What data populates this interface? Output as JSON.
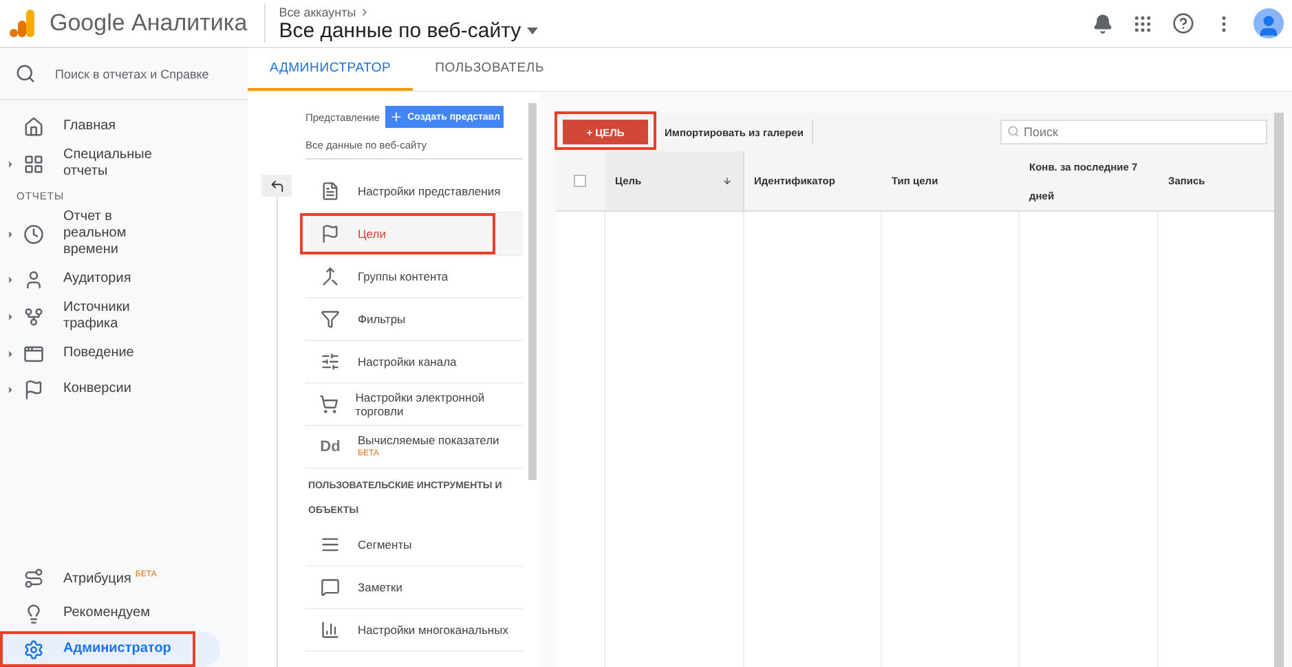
{
  "header": {
    "product": "Google Аналитика",
    "breadcrumb": "Все аккаунты",
    "view_title": "Все данные по веб-сайту"
  },
  "sidebar": {
    "search_placeholder": "Поиск в отчетах и Справке",
    "top_items": [
      {
        "label": "Главная",
        "expandable": false
      },
      {
        "label": "Специальные отчеты",
        "expandable": true
      }
    ],
    "section": "ОТЧЕТЫ",
    "report_items": [
      {
        "label": "Отчет в реальном времени",
        "expandable": true
      },
      {
        "label": "Аудитория",
        "expandable": true
      },
      {
        "label": "Источники трафика",
        "expandable": true
      },
      {
        "label": "Поведение",
        "expandable": true
      },
      {
        "label": "Конверсии",
        "expandable": true
      }
    ],
    "bottom_items": [
      {
        "label": "Атрибуция",
        "badge": "БЕТА",
        "selected": false,
        "highlighted": false
      },
      {
        "label": "Рекомендуем",
        "selected": false,
        "highlighted": false
      },
      {
        "label": "Администратор",
        "selected": true,
        "highlighted": true
      }
    ]
  },
  "tabs": [
    {
      "label": "АДМИНИСТРАТОР",
      "selected": true
    },
    {
      "label": "ПОЛЬЗОВАТЕЛЬ",
      "selected": false
    }
  ],
  "view_panel": {
    "label": "Представление",
    "create_button": "Создать представл",
    "view_name": "Все данные по веб-сайту",
    "items": [
      {
        "label": "Настройки представления",
        "selected": false,
        "highlighted": false
      },
      {
        "label": "Цели",
        "selected": true,
        "highlighted": true
      },
      {
        "label": "Группы контента",
        "selected": false,
        "highlighted": false
      },
      {
        "label": "Фильтры",
        "selected": false,
        "highlighted": false
      },
      {
        "label": "Настройки канала",
        "selected": false,
        "highlighted": false
      },
      {
        "label": "Настройки электронной торговли",
        "selected": false,
        "highlighted": false
      },
      {
        "label": "Вычисляемые показатели",
        "badge": "БЕТА",
        "icon_text": "Dd",
        "selected": false,
        "highlighted": false
      }
    ],
    "section": "ПОЛЬЗОВАТЕЛЬСКИЕ ИНСТРУМЕНТЫ И ОБЪЕКТЫ",
    "section_items": [
      {
        "label": "Сегменты"
      },
      {
        "label": "Заметки"
      },
      {
        "label": "Настройки многоканальных"
      }
    ]
  },
  "goals": {
    "new_button": "+ ЦЕЛЬ",
    "new_highlighted": true,
    "import_button": "Импортировать из галереи",
    "search_placeholder": "Поиск",
    "select_all_checked": false,
    "columns": [
      {
        "label": "Цель",
        "sorted": true
      },
      {
        "label": "Идентификатор",
        "sorted": false
      },
      {
        "label": "Тип цели",
        "sorted": false
      },
      {
        "label": "Конв. за последние 7 дней",
        "sorted": false
      },
      {
        "label": "Запись",
        "sorted": false
      }
    ]
  }
}
